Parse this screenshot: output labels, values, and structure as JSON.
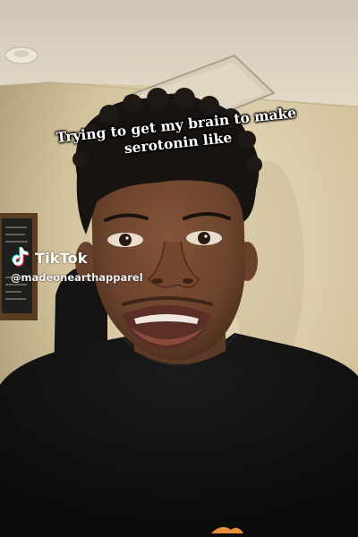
{
  "caption": {
    "line1": "Trying to get my brain to make",
    "line2": "serotonin like"
  },
  "watermark": {
    "brand": "TikTok",
    "handle": "@madeonearthapparel",
    "icon": "tiktok-logo-icon"
  },
  "colors": {
    "wall": "#d9cba8",
    "shirt": "#121110",
    "skin": "#6e4630",
    "hair": "#161210",
    "caption_text": "#ffffff",
    "logo_cyan": "#25f4ee",
    "logo_red": "#fe2c55"
  }
}
